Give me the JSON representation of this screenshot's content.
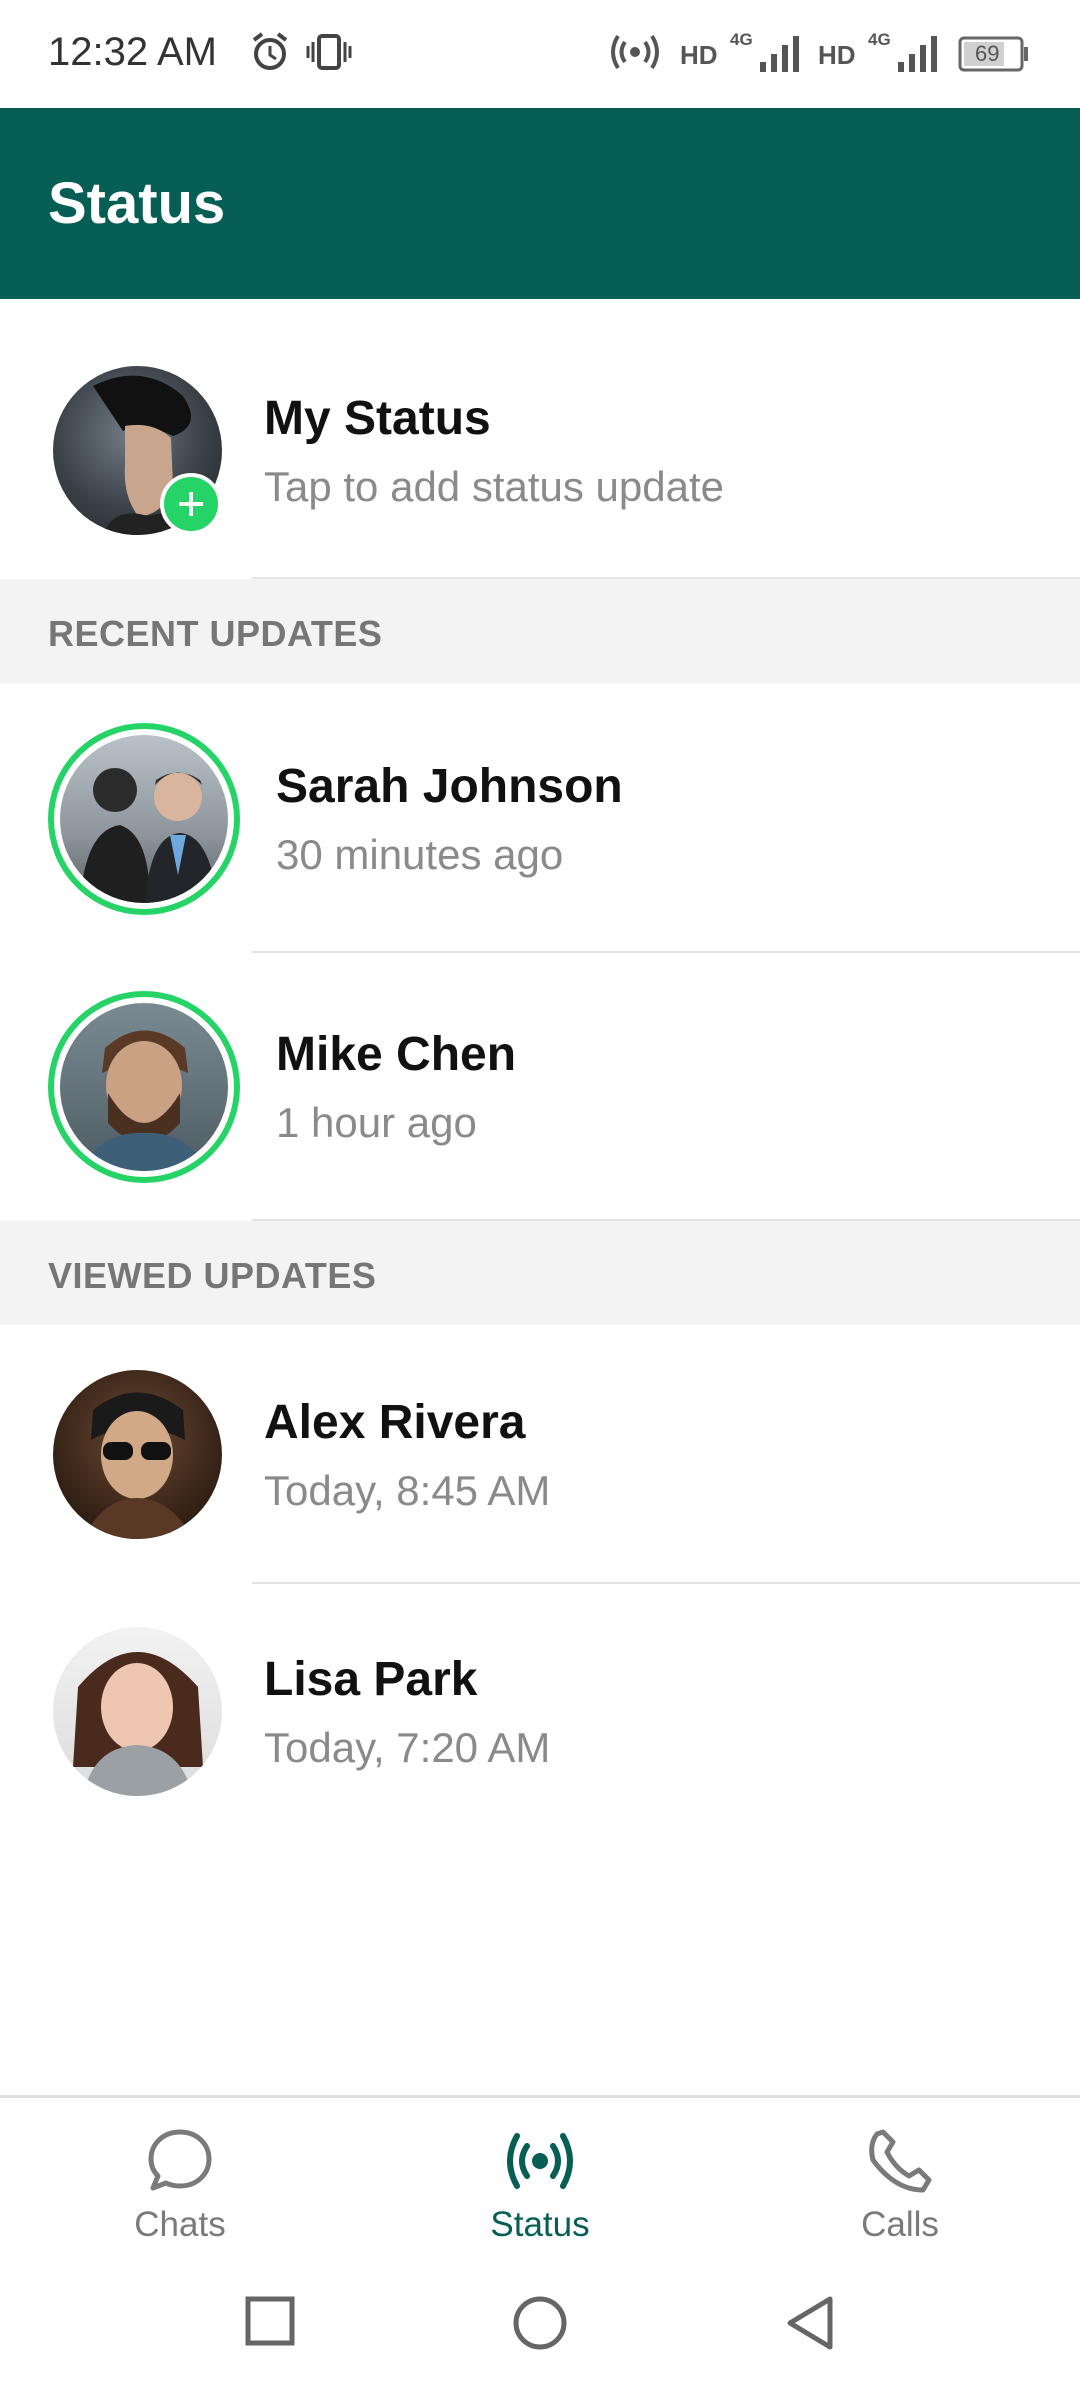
{
  "status_bar": {
    "time": "12:32 AM",
    "hd_1": "HD",
    "net_1": "4G",
    "hd_2": "HD",
    "net_2": "4G",
    "battery": "69"
  },
  "app_bar": {
    "title": "Status"
  },
  "my_status": {
    "name": "My Status",
    "subtitle": "Tap to add status update"
  },
  "sections": {
    "recent": "RECENT UPDATES",
    "viewed": "VIEWED UPDATES"
  },
  "recent_updates": [
    {
      "name": "Sarah Johnson",
      "time": "30 minutes ago"
    },
    {
      "name": "Mike Chen",
      "time": "1 hour ago"
    }
  ],
  "viewed_updates": [
    {
      "name": "Alex Rivera",
      "time": "Today, 8:45 AM"
    },
    {
      "name": "Lisa Park",
      "time": "Today, 7:20 AM"
    }
  ],
  "bottom_nav": [
    {
      "label": "Chats",
      "icon": "chat-bubble-icon",
      "active": false
    },
    {
      "label": "Status",
      "icon": "broadcast-icon",
      "active": true
    },
    {
      "label": "Calls",
      "icon": "phone-icon",
      "active": false
    }
  ],
  "colors": {
    "primary": "#075e54",
    "accent": "#25d366",
    "section_bg": "#f3f3f3"
  }
}
